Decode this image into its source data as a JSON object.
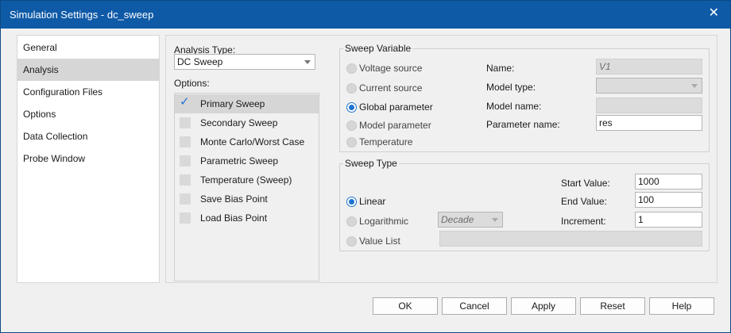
{
  "window": {
    "title": "Simulation Settings - dc_sweep",
    "close_glyph": "✕"
  },
  "nav": {
    "items": [
      "General",
      "Analysis",
      "Configuration Files",
      "Options",
      "Data Collection",
      "Probe Window"
    ],
    "selected": "Analysis"
  },
  "analysis": {
    "type_label": "Analysis Type:",
    "type_value": "DC Sweep",
    "options_label": "Options:",
    "options": [
      {
        "label": "Primary Sweep",
        "checked": true
      },
      {
        "label": "Secondary Sweep",
        "checked": false
      },
      {
        "label": "Monte Carlo/Worst Case",
        "checked": false
      },
      {
        "label": "Parametric Sweep",
        "checked": false
      },
      {
        "label": "Temperature (Sweep)",
        "checked": false
      },
      {
        "label": "Save Bias Point",
        "checked": false
      },
      {
        "label": "Load Bias Point",
        "checked": false
      }
    ]
  },
  "sweep_variable": {
    "title": "Sweep Variable",
    "radios": [
      "Voltage source",
      "Current source",
      "Global parameter",
      "Model parameter",
      "Temperature"
    ],
    "selected": "Global parameter",
    "name_label": "Name:",
    "name_value": "V1",
    "model_type_label": "Model type:",
    "model_type_value": "",
    "model_name_label": "Model name:",
    "model_name_value": "",
    "param_name_label": "Parameter name:",
    "param_name_value": "res"
  },
  "sweep_type": {
    "title": "Sweep Type",
    "radios": [
      "Linear",
      "Logarithmic",
      "Value List"
    ],
    "selected": "Linear",
    "log_mode_value": "Decade",
    "start_label": "Start Value:",
    "start_value": "1000",
    "end_label": "End Value:",
    "end_value": "100",
    "increment_label": "Increment:",
    "increment_value": "1",
    "value_list_value": ""
  },
  "buttons": {
    "ok": "OK",
    "cancel": "Cancel",
    "apply": "Apply",
    "reset": "Reset",
    "help": "Help"
  },
  "colors": {
    "titlebar": "#0e5aa7",
    "accent": "#1e73d2",
    "selected_row": "#d6d6d6"
  }
}
